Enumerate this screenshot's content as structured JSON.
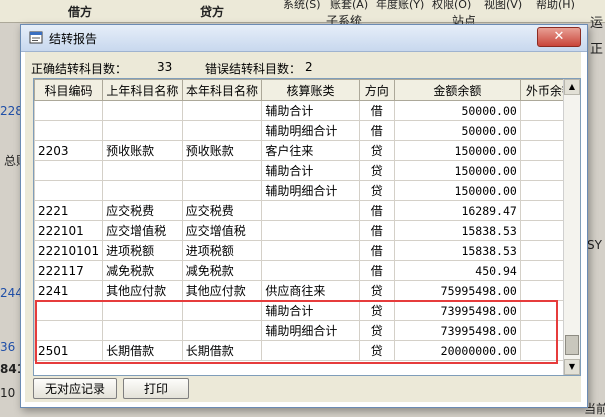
{
  "background": {
    "menu_items": [
      "系统(S)",
      "账套(A)",
      "年度账(Y)",
      "权限(O)",
      "视图(V)",
      "帮助(H)"
    ],
    "top_headers": [
      "借方",
      "贷方"
    ],
    "top_sub": [
      "子系统",
      "站点"
    ],
    "side_text_1": "总账",
    "side_nums": [
      "228",
      "244",
      "36",
      "841",
      "10"
    ],
    "right_chars": [
      "运",
      "正",
      "SY"
    ],
    "bottom_right": "当前"
  },
  "dialog": {
    "title": "结转报告",
    "close_label": "✕",
    "correct_label": "正确结转科目数：",
    "correct_count": "33",
    "error_label": "错误结转科目数：",
    "error_count": "2",
    "columns": [
      "科目编码",
      "上年科目名称",
      "本年科目名称",
      "核算账类",
      "方向",
      "金额余额",
      "外币余额"
    ],
    "rows": [
      [
        "",
        "",
        "",
        "辅助合计",
        "借",
        "50000.00"
      ],
      [
        "",
        "",
        "",
        "辅助明细合计",
        "借",
        "50000.00"
      ],
      [
        "2203",
        "预收账款",
        "预收账款",
        "客户往来",
        "贷",
        "150000.00"
      ],
      [
        "",
        "",
        "",
        "辅助合计",
        "贷",
        "150000.00"
      ],
      [
        "",
        "",
        "",
        "辅助明细合计",
        "贷",
        "150000.00"
      ],
      [
        "2221",
        "应交税费",
        "应交税费",
        "",
        "借",
        "16289.47"
      ],
      [
        "222101",
        "应交增值税",
        "应交增值税",
        "",
        "借",
        "15838.53"
      ],
      [
        "22210101",
        "进项税额",
        "进项税额",
        "",
        "借",
        "15838.53"
      ],
      [
        "222117",
        "减免税款",
        "减免税款",
        "",
        "借",
        "450.94"
      ],
      [
        "2241",
        "其他应付款",
        "其他应付款",
        "供应商往来",
        "贷",
        "75995498.00"
      ],
      [
        "",
        "",
        "",
        "辅助合计",
        "贷",
        "73995498.00"
      ],
      [
        "",
        "",
        "",
        "辅助明细合计",
        "贷",
        "73995498.00"
      ],
      [
        "2501",
        "长期借款",
        "长期借款",
        "",
        "贷",
        "20000000.00"
      ]
    ],
    "btn_no_match": "无对应记录",
    "btn_print": "打印"
  }
}
